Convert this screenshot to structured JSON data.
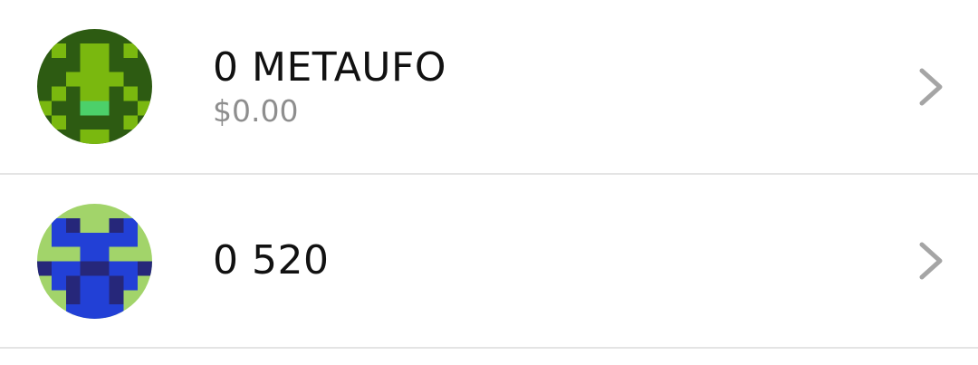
{
  "tokens": [
    {
      "amount_label": "0 METAUFO",
      "fiat_value": "$0.00",
      "avatar_icon": "pixel-identicon-green",
      "avatar_colors": {
        "bg": "#2d5b12",
        "light": "#7ab80f",
        "accent": "#4cd06a"
      }
    },
    {
      "amount_label": "0 520",
      "avatar_icon": "pixel-identicon-blue",
      "avatar_colors": {
        "bg": "#a2d46a",
        "main": "#2240d6",
        "dark": "#26277a"
      }
    }
  ],
  "chevron_icon": "chevron-right-icon",
  "divider_color": "#e4e4e4",
  "chevron_color": "#a5a5a5"
}
